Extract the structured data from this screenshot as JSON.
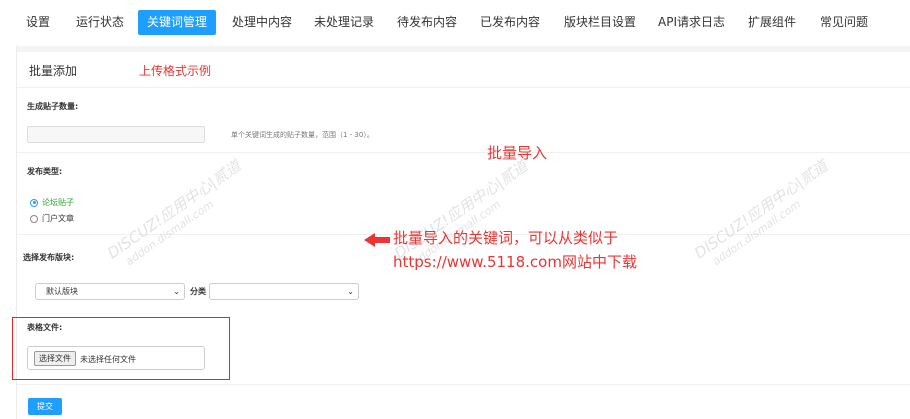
{
  "nav": {
    "tabs": [
      "设置",
      "运行状态",
      "关键词管理",
      "处理中内容",
      "未处理记录",
      "待发布内容",
      "已发布内容",
      "版块栏目设置",
      "API请求日志",
      "扩展组件",
      "常见问题"
    ],
    "active_index": 2
  },
  "main": {
    "title": "批量添加",
    "example_link": "上传格式示例",
    "count_label": "生成贴子数量:",
    "count_hint": "单个关键词生成的贴子数量，范围（1 - 30）。",
    "type_label": "发布类型:",
    "type_options": [
      "论坛贴子",
      "门户文章"
    ],
    "type_selected": "论坛贴子",
    "forum_label": "选择发布版块:",
    "forum_select_value": "默认版块",
    "category_label": "分类",
    "category_select_value": "",
    "file_label": "表格文件:",
    "file_button": "选择文件",
    "file_status": "未选择任何文件",
    "submit": "提交"
  },
  "annotations": {
    "batch_import": "批量导入",
    "keywords_note": "批量导入的关键词，可以从类似于 https://www.5118.com网站中下载"
  },
  "watermark": {
    "line1": "DISCUZ!应用中心|贰道",
    "line2": "addon.dismall.com"
  },
  "colors": {
    "accent": "#1e9fff",
    "annotation": "#e33333",
    "selected_option": "#2aa52a"
  }
}
